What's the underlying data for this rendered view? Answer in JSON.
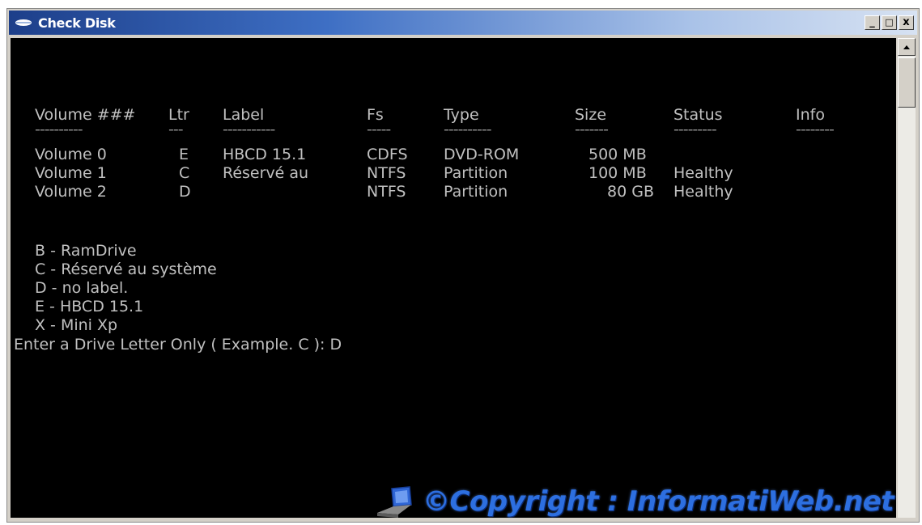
{
  "window": {
    "title": "Check Disk",
    "controls": {
      "minimize": "_",
      "maximize": "□",
      "close": "x"
    }
  },
  "console": {
    "volumes_header": [
      "Volume ###",
      "Ltr",
      "Label",
      "Fs",
      "Type",
      "Size",
      "Status",
      "Info"
    ],
    "volumes_separator": [
      "----------",
      "---",
      "-----------",
      "-----",
      "----------",
      "-------",
      "---------",
      "--------"
    ],
    "volumes": [
      {
        "volume": "Volume 0",
        "ltr": "E",
        "label": "HBCD 15.1",
        "fs": "CDFS",
        "type": "DVD-ROM",
        "size": "500 MB",
        "status": "",
        "info": ""
      },
      {
        "volume": "Volume 1",
        "ltr": "C",
        "label": "Réservé au",
        "fs": "NTFS",
        "type": "Partition",
        "size": "100 MB",
        "status": "Healthy",
        "info": ""
      },
      {
        "volume": "Volume 2",
        "ltr": "D",
        "label": "",
        "fs": "NTFS",
        "type": "Partition",
        "size": "80 GB",
        "status": "Healthy",
        "info": ""
      }
    ],
    "drive_list": [
      "B - RamDrive",
      "C - Réservé au système",
      "D - no label.",
      "E - HBCD 15.1",
      "X - Mini Xp"
    ],
    "prompt": "Enter a Drive Letter Only ( Example. C ): D"
  },
  "watermark": "©Copyright : InformatiWeb.net",
  "colors": {
    "console_bg": "#000000",
    "console_text": "#c0c0c0",
    "titlebar_start": "#1d3f8a",
    "titlebar_end": "#d7e2f2",
    "watermark": "#2d6fe0"
  }
}
